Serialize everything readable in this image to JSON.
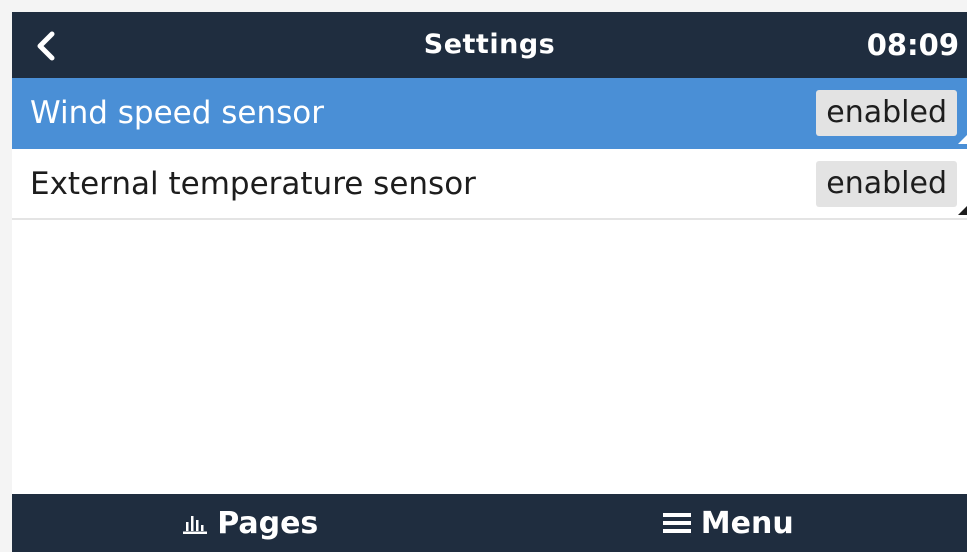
{
  "header": {
    "title": "Settings",
    "clock": "08:09",
    "back_icon": "chevron-left-icon"
  },
  "list": {
    "items": [
      {
        "label": "Wind speed sensor",
        "value": "enabled",
        "selected": true
      },
      {
        "label": "External temperature sensor",
        "value": "enabled",
        "selected": false
      }
    ]
  },
  "footer": {
    "pages_label": "Pages",
    "pages_icon": "bar-chart-icon",
    "menu_label": "Menu",
    "menu_icon": "hamburger-icon"
  },
  "colors": {
    "header_bg": "#1f2d3f",
    "selected_row": "#4a8fd6",
    "value_badge": "#e3e3e3"
  }
}
